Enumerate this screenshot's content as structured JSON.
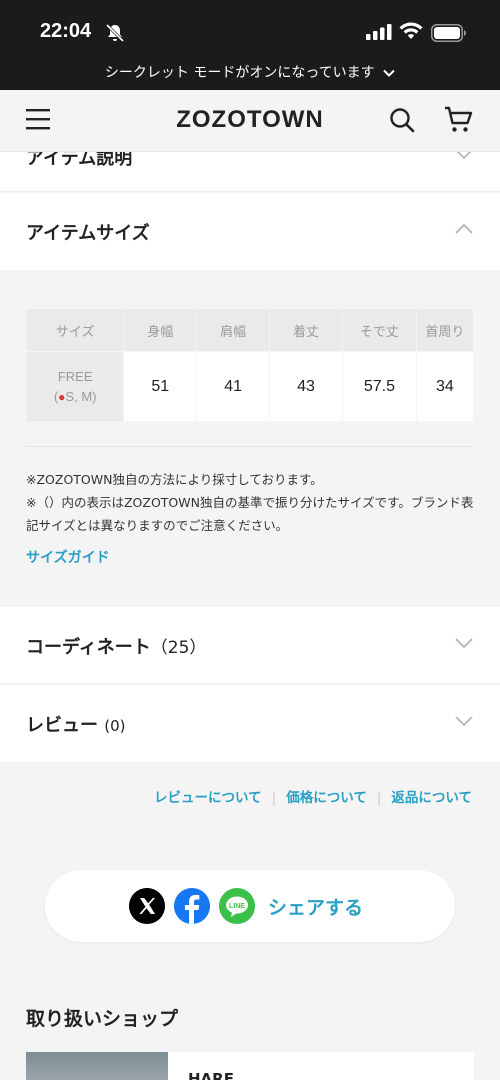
{
  "status_bar": {
    "time": "22:04"
  },
  "incognito_bar": {
    "text": "シークレット モードがオンになっています"
  },
  "header": {
    "logo": "ZOZOTOWN"
  },
  "sections": {
    "item_description": {
      "title": "アイテム説明"
    },
    "item_size": {
      "title": "アイテムサイズ"
    },
    "coordinate": {
      "title": "コーディネート",
      "count": "（25）"
    },
    "review": {
      "title": "レビュー",
      "count": "(0)"
    }
  },
  "size_table": {
    "headers": [
      "サイズ",
      "身幅",
      "肩幅",
      "着丈",
      "そで丈",
      "首周り"
    ],
    "row": {
      "size_label": "FREE",
      "size_sub": "S, M",
      "values": [
        "51",
        "41",
        "43",
        "57.5",
        "34"
      ]
    }
  },
  "size_notes": {
    "line1": "※ZOZOTOWN独自の方法により採寸しております。",
    "line2": "※（）内の表示はZOZOTOWN独自の基準で振り分けたサイズです。ブランド表記サイズとは異なりますのでご注意ください。",
    "guide_link": "サイズガイド"
  },
  "footer_links": [
    "レビューについて",
    "価格について",
    "返品について"
  ],
  "share": {
    "label": "シェアする",
    "icons": [
      "x-icon",
      "facebook-icon",
      "line-icon"
    ],
    "line_icon_text": "LINE"
  },
  "shop": {
    "heading": "取り扱いショップ",
    "name": "HARE"
  },
  "colors": {
    "accent": "#2a9fc4",
    "status_bar_bg": "#1b1b1b",
    "page_bg": "#f4f4f4"
  }
}
